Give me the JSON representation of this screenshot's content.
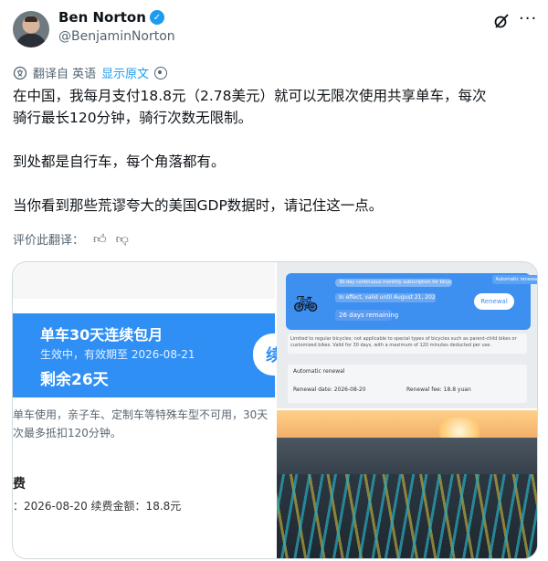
{
  "author": {
    "name": "Ben Norton",
    "handle": "@BenjaminNorton",
    "verified": true
  },
  "icons": {
    "verified": "verified-badge-icon",
    "grok": "grok-icon",
    "more": "more-icon",
    "translate": "translate-icon",
    "settings": "settings-icon",
    "thumbs_up": "thumbs-up-icon",
    "thumbs_down": "thumbs-down-icon"
  },
  "translation_bar": {
    "label": "翻译自 英语",
    "show_original": "显示原文"
  },
  "tweet": {
    "line1": "在中国，我每月支付18.8元（2.78美元）就可以无限次使用共享单车，每次",
    "line2": "骑行最长120分钟，骑行次数无限制。",
    "para2": "到处都是自行车，每个角落都有。",
    "para3": "当你看到那些荒谬夸大的美国GDP数据时，请记住这一点。"
  },
  "rate_translation": {
    "label": "评价此翻译："
  },
  "media": {
    "left": {
      "card_title": "单车30天连续包月",
      "card_status": "生效中，有效期至 2026-08-21",
      "card_remaining": "剩余26天",
      "card_button_partial": "续",
      "desc_line1": "单车使用，亲子车、定制车等特殊车型不可用，30天",
      "desc_line2": "次最多抵扣120分钟。",
      "fee_label": "费",
      "renew_line": "：2026-08-20   续费金额：18.8元"
    },
    "right_top": {
      "subscription": "30-day continuous monthly subscription for bicycles",
      "valid": "In effect, valid until August 21, 2026",
      "remaining": "26 days remaining",
      "auto_badge": "Automatic renewal",
      "renewal_button": "Renewal",
      "note": "Limited to regular bicycles; not applicable to special types of bicycles such as parent-child bikes or customized bikes. Valid for 30 days, with a maximum of 120 minutes deducted per use.",
      "box_title": "Automatic renewal",
      "renewal_date": "Renewal date: 2026-08-20",
      "renewal_fee": "Renewal fee: 18.8 yuan"
    },
    "right_bottom": {
      "alt": "photo-of-shared-bikes"
    }
  },
  "colors": {
    "accent": "#1d9bf0",
    "card_blue": "#2f8ff5"
  }
}
